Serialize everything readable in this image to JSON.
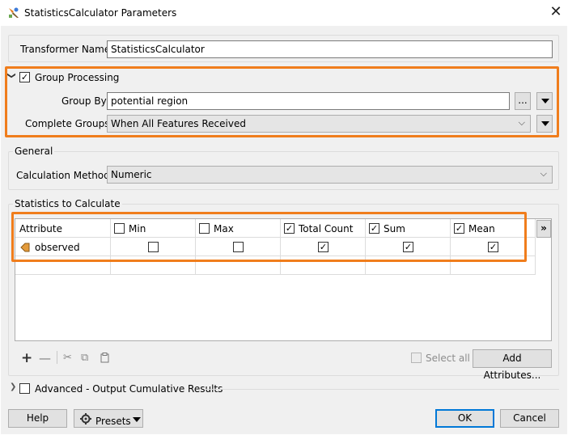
{
  "window": {
    "title": "StatisticsCalculator Parameters",
    "close_glyph": "✕",
    "app_icon": "fme-transformer-icon"
  },
  "transformer": {
    "label": "Transformer Name:",
    "value": "StatisticsCalculator"
  },
  "group_processing": {
    "toggle_glyph": "❯",
    "checked": true,
    "label": "Group Processing",
    "group_by": {
      "label": "Group By:",
      "value": "potential region",
      "browse_label": "..."
    },
    "complete_groups": {
      "label": "Complete Groups:",
      "value": "When All Features Received"
    }
  },
  "general": {
    "title": "General",
    "calc_method": {
      "label": "Calculation Method:",
      "value": "Numeric"
    }
  },
  "stats": {
    "title": "Statistics to Calculate",
    "more_label": "»",
    "columns": [
      {
        "label": "Attribute"
      },
      {
        "label": "Min",
        "checked": false
      },
      {
        "label": "Max",
        "checked": false
      },
      {
        "label": "Total Count",
        "checked": true
      },
      {
        "label": "Sum",
        "checked": true
      },
      {
        "label": "Mean",
        "checked": true
      }
    ],
    "rows": [
      {
        "attribute": "observed",
        "icon": "attribute-tag-icon",
        "min": false,
        "max": false,
        "total_count": true,
        "sum": true,
        "mean": true
      }
    ],
    "toolbar": {
      "add": "+",
      "remove": "—",
      "cut": "✂",
      "copy": "⧉",
      "paste": "📋"
    },
    "select_all": "Select all",
    "add_attributes": "Add Attributes..."
  },
  "advanced": {
    "label": "Advanced - Output Cumulative Results",
    "checked": false
  },
  "footer": {
    "help": "Help",
    "presets": "Presets",
    "ok": "OK",
    "cancel": "Cancel"
  },
  "colors": {
    "highlight": "#f07d1c",
    "ok_border": "#0078d7",
    "dialog_bg": "#f0f0f0"
  }
}
